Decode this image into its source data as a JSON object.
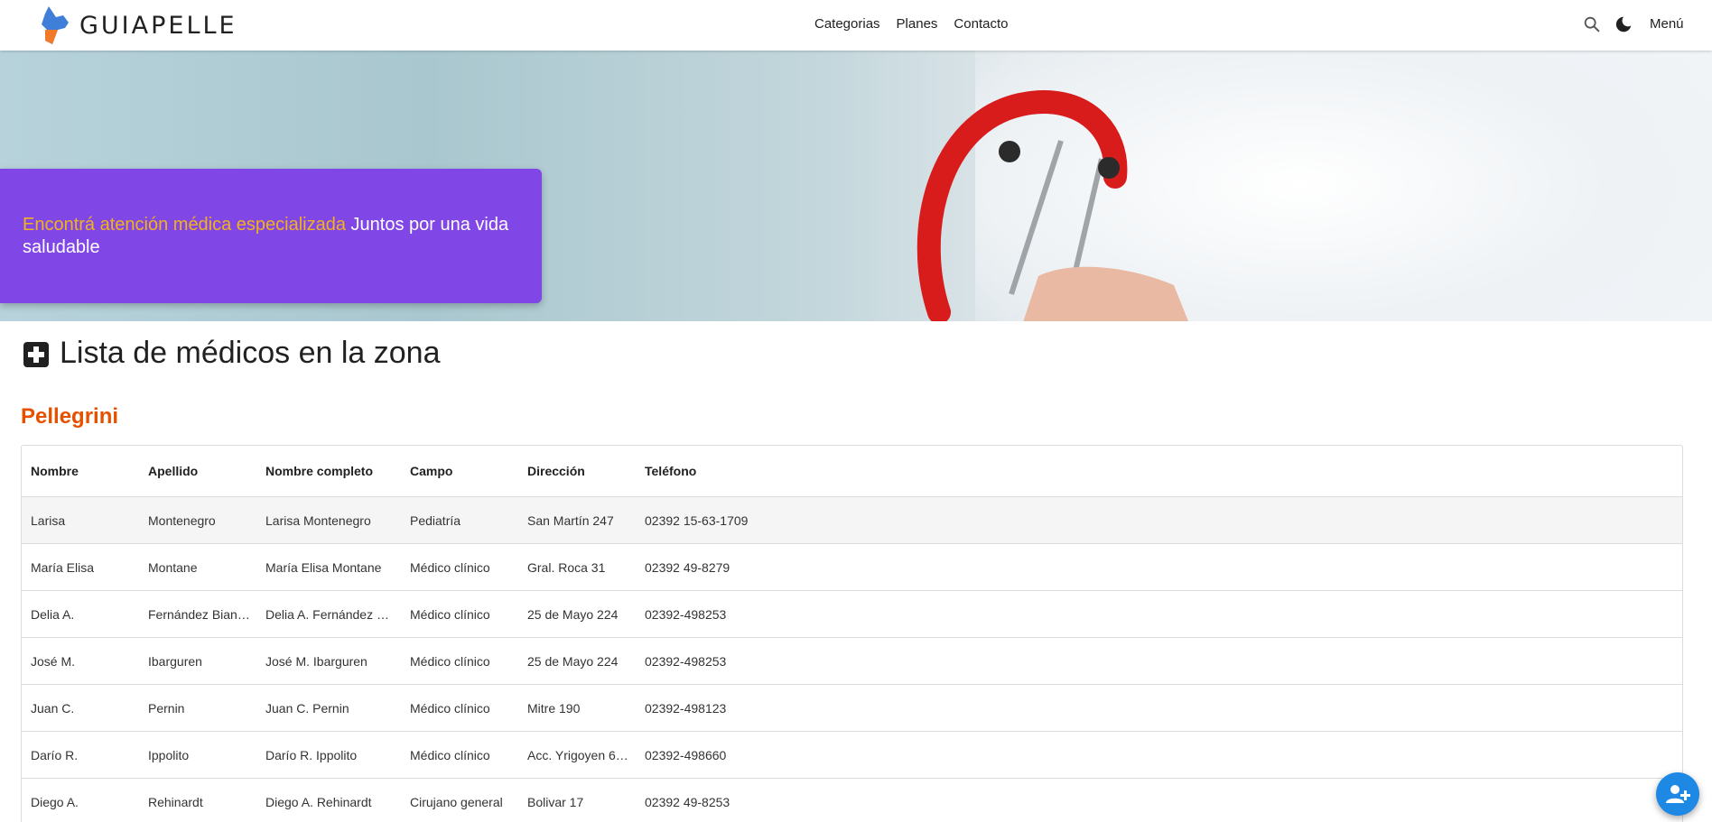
{
  "header": {
    "brand": "GUIAPELLE",
    "nav": [
      "Categorias",
      "Planes",
      "Contacto"
    ],
    "menu_label": "Menú",
    "search_icon": "search-icon",
    "theme_icon": "moon-icon"
  },
  "hero": {
    "highlight": "Encontrá atención médica especializada",
    "text": " Juntos por una vida saludable"
  },
  "section": {
    "title": "Lista de médicos en la zona",
    "icon": "medical-cross-icon",
    "town": "Pellegrini"
  },
  "table": {
    "columns": [
      "Nombre",
      "Apellido",
      "Nombre completo",
      "Campo",
      "Dirección",
      "Teléfono"
    ],
    "rows": [
      [
        "Larisa",
        "Montenegro",
        "Larisa Montenegro",
        "Pediatría",
        "San Martín 247",
        "02392 15-63-1709"
      ],
      [
        "María Elisa",
        "Montane",
        "María Elisa Montane",
        "Médico clínico",
        "Gral. Roca 31",
        "02392 49-8279"
      ],
      [
        "Delia A.",
        "Fernández Bian…",
        "Delia A. Fernández …",
        "Médico clínico",
        "25 de Mayo 224",
        "02392-498253"
      ],
      [
        "José M.",
        "Ibarguren",
        "José M. Ibarguren",
        "Médico clínico",
        "25 de Mayo 224",
        "02392-498253"
      ],
      [
        "Juan C.",
        "Pernin",
        "Juan C. Pernin",
        "Médico clínico",
        "Mitre 190",
        "02392-498123"
      ],
      [
        "Darío R.",
        "Ippolito",
        "Darío R. Ippolito",
        "Médico clínico",
        "Acc. Yrigoyen 6…",
        "02392-498660"
      ],
      [
        "Diego A.",
        "Rehinardt",
        "Diego A. Rehinardt",
        "Cirujano general",
        "Bolivar 17",
        "02392 49-8253"
      ]
    ]
  },
  "fab": {
    "icon": "add-person-icon"
  },
  "colors": {
    "promo_bg": "#8047e6",
    "promo_highlight": "#f2b21b",
    "town_title": "#e65100",
    "fab": "#1e88e5"
  }
}
